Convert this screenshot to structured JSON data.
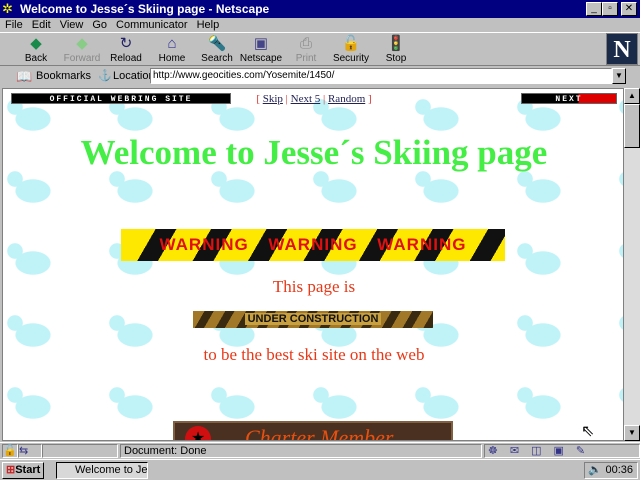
{
  "window": {
    "title": "Welcome to Jesse´s Skiing page - Netscape"
  },
  "menu": [
    "File",
    "Edit",
    "View",
    "Go",
    "Communicator",
    "Help"
  ],
  "toolbar": [
    {
      "label": "Back",
      "icon": "back-arrow-icon",
      "enabled": true
    },
    {
      "label": "Forward",
      "icon": "forward-arrow-icon",
      "enabled": false
    },
    {
      "label": "Reload",
      "icon": "reload-icon",
      "enabled": true
    },
    {
      "label": "Home",
      "icon": "home-icon",
      "enabled": true
    },
    {
      "label": "Search",
      "icon": "search-icon",
      "enabled": true
    },
    {
      "label": "Netscape",
      "icon": "netscape-icon",
      "enabled": true
    },
    {
      "label": "Print",
      "icon": "print-icon",
      "enabled": false
    },
    {
      "label": "Security",
      "icon": "security-lock-icon",
      "enabled": true
    },
    {
      "label": "Stop",
      "icon": "stop-icon",
      "enabled": true
    }
  ],
  "logo": "N",
  "location": {
    "bookmarks_label": "Bookmarks",
    "label": "Location:",
    "url": "http://www.geocities.com/Yosemite/1450/"
  },
  "page": {
    "webring_banner": "OFFICIAL WEBRING SITE",
    "links": {
      "open": "[",
      "skip": "Skip",
      "next5": "Next 5",
      "random": "Random",
      "close": "]"
    },
    "next_banner": "NEXT",
    "heading": "Welcome to Jesse´s Skiing page",
    "warning": "WARNING WARNING WARNING",
    "line1": "This page is",
    "under_construction": "UNDER CONSTRUCTION",
    "line2": "to be the best ski site on the web",
    "charter_banner": "Charter Member"
  },
  "status": {
    "text": "Document: Done"
  },
  "taskbar": {
    "start": "Start",
    "task": "Welcome to Jesse´s ...",
    "clock": "00:36"
  }
}
